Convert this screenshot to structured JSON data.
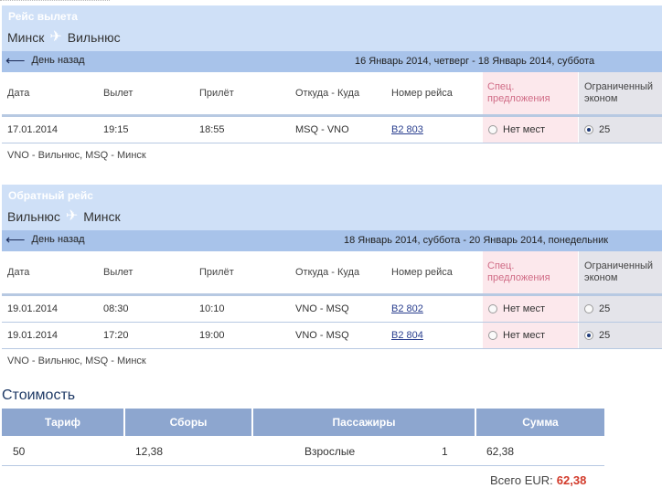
{
  "outbound": {
    "title": "Рейс вылета",
    "route_from": "Минск",
    "route_to": "Вильнюс",
    "back_label": "День назад",
    "date_range": "16 Январь 2014, четверг - 18 Январь 2014, суббота",
    "columns": {
      "date": "Дата",
      "departure": "Вылет",
      "arrival": "Прилёт",
      "from_to": "Откуда - Куда",
      "flight_no": "Номер рейса",
      "special_1": "Спец.",
      "special_2": "предложения",
      "economy_1": "Ограниченный",
      "economy_2": "эконом"
    },
    "rows": [
      {
        "date": "17.01.2014",
        "dep": "19:15",
        "arr": "18:55",
        "route": "MSQ - VNO",
        "flight": "B2 803",
        "special": "Нет мест",
        "economy": "25",
        "economy_selected": true
      }
    ],
    "airports_note": "VNO - Вильнюс, MSQ - Минск"
  },
  "return": {
    "title": "Обратный рейс",
    "route_from": "Вильнюс",
    "route_to": "Минск",
    "back_label": "День назад",
    "date_range": "18 Январь 2014, суббота - 20 Январь 2014, понедельник",
    "columns": {
      "date": "Дата",
      "departure": "Вылет",
      "arrival": "Прилёт",
      "from_to": "Откуда - Куда",
      "flight_no": "Номер рейса",
      "special_1": "Спец.",
      "special_2": "предложения",
      "economy_1": "Ограниченный",
      "economy_2": "эконом"
    },
    "rows": [
      {
        "date": "19.01.2014",
        "dep": "08:30",
        "arr": "10:10",
        "route": "VNO - MSQ",
        "flight": "B2 802",
        "special": "Нет мест",
        "economy": "25",
        "economy_selected": false
      },
      {
        "date": "19.01.2014",
        "dep": "17:20",
        "arr": "19:00",
        "route": "VNO - MSQ",
        "flight": "B2 804",
        "special": "Нет мест",
        "economy": "25",
        "economy_selected": true
      }
    ],
    "airports_note": "VNO - Вильнюс, MSQ - Минск"
  },
  "cost": {
    "title": "Стоимость",
    "headers": {
      "tariff": "Тариф",
      "fees": "Сборы",
      "passengers": "Пассажиры",
      "sum": "Сумма"
    },
    "row": {
      "tariff": "50",
      "fees": "12,38",
      "passenger_type": "Взрослые",
      "count": "1",
      "sum": "62,38"
    },
    "total_label": "Всего EUR:",
    "total_amount": "62,38"
  },
  "icons": {
    "plane": "airplane-icon",
    "back": "arrow-left-icon"
  },
  "colors": {
    "header_bg": "#cfe0f7",
    "nav_bg": "#a8c3ea",
    "special_bg": "#fce8ec",
    "economy_bg": "#e4e4ea",
    "total_amount": "#d23a2a"
  }
}
